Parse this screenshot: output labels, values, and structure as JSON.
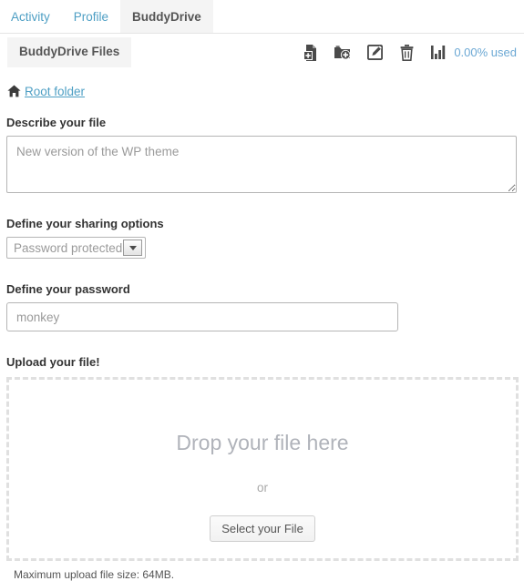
{
  "nav": {
    "tabs": [
      {
        "label": "Activity",
        "active": false
      },
      {
        "label": "Profile",
        "active": false
      },
      {
        "label": "BuddyDrive",
        "active": true
      }
    ]
  },
  "section": {
    "title": "BuddyDrive Files",
    "toolbar": {
      "add_file_icon": "file-plus-icon",
      "add_folder_icon": "folder-plus-icon",
      "edit_icon": "edit-square-icon",
      "delete_icon": "trash-icon",
      "stats_icon": "bar-chart-icon",
      "usage_label": "0.00% used",
      "usage_color": "#6ba8d4"
    }
  },
  "breadcrumb": {
    "home_icon": "home-icon",
    "root_label": "Root folder",
    "link_color": "#4e9fc4"
  },
  "form": {
    "describe": {
      "label": "Describe your file",
      "value": "New version of the WP theme",
      "placeholder": "New version of the WP theme"
    },
    "sharing": {
      "label": "Define your sharing options",
      "selected": "Password protected",
      "options": [
        "Password protected"
      ]
    },
    "password": {
      "label": "Define your password",
      "value": "monkey",
      "placeholder": "monkey"
    },
    "upload": {
      "label": "Upload your file!",
      "drop_text": "Drop your file here",
      "or_text": "or",
      "select_button": "Select your File",
      "max_size": "Maximum upload file size: 64MB."
    }
  }
}
